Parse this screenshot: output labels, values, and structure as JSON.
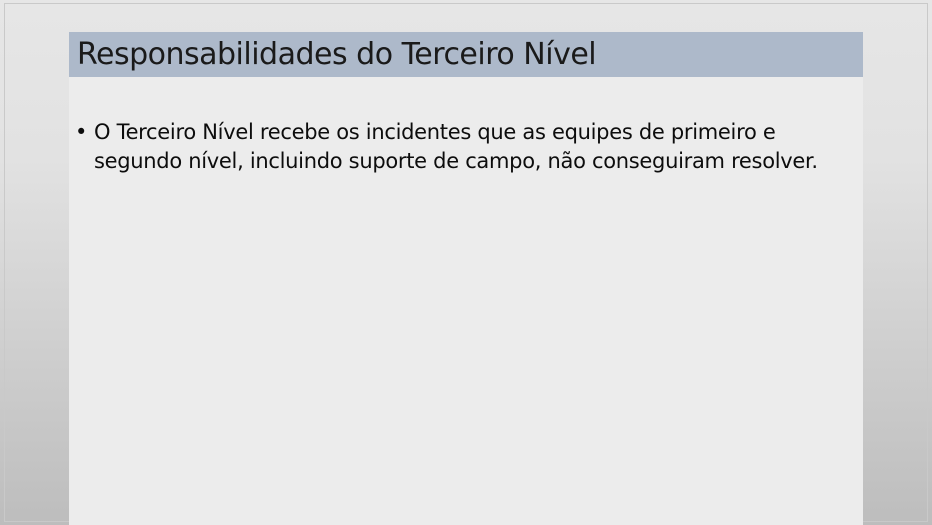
{
  "slide": {
    "title": "Responsabilidades do Terceiro Nível",
    "bullets": [
      {
        "marker": "•",
        "text": "O Terceiro Nível recebe os incidentes que as equipes de primeiro e segundo nível, incluindo suporte de campo, não conseguiram resolver."
      }
    ],
    "colors": {
      "title_bar": "#adb9ca",
      "content_background": "#ececec",
      "page_background": "#e2e2e2",
      "text": "#0d0d0d"
    }
  }
}
